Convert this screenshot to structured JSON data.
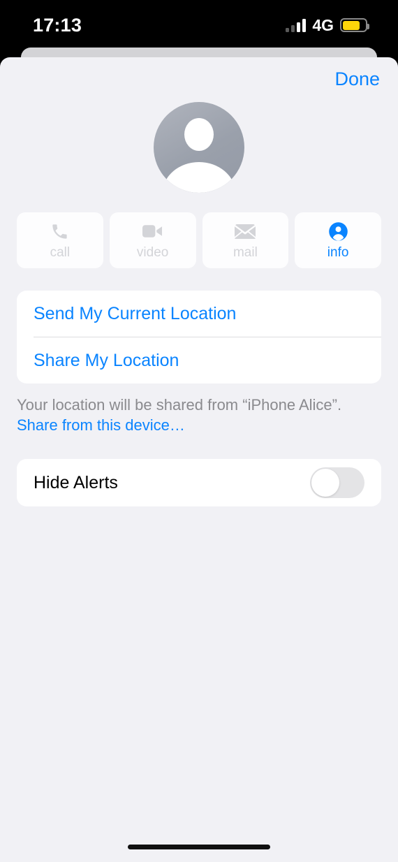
{
  "status_bar": {
    "time": "17:13",
    "network_label": "4G",
    "signal_icon": "signal-bars-icon",
    "signal_bars_active": 2,
    "signal_bars_total": 4,
    "battery_icon": "battery-icon",
    "battery_level_percent": 78,
    "battery_color": "#FFD60A"
  },
  "header": {
    "done_label": "Done"
  },
  "contact": {
    "avatar_icon": "default-person-avatar-icon"
  },
  "actions": [
    {
      "id": "call",
      "label": "call",
      "icon": "phone-icon",
      "enabled": false
    },
    {
      "id": "video",
      "label": "video",
      "icon": "video-camera-icon",
      "enabled": false
    },
    {
      "id": "mail",
      "label": "mail",
      "icon": "envelope-icon",
      "enabled": false
    },
    {
      "id": "info",
      "label": "info",
      "icon": "person-circle-icon",
      "enabled": true
    }
  ],
  "location_card": {
    "send_current_location_label": "Send My Current Location",
    "share_my_location_label": "Share My Location"
  },
  "footer": {
    "note": "Your location will be shared from “iPhone Alice”.",
    "link": "Share from this device…"
  },
  "alerts_card": {
    "hide_alerts_label": "Hide Alerts",
    "hide_alerts_on": false
  },
  "colors": {
    "accent_blue": "#0A84FF",
    "background": "#F1F1F5",
    "card": "#FFFFFF",
    "disabled_gray": "#D3D4D8",
    "note_gray": "#8A8A8E"
  },
  "system": {
    "home_indicator": "home-indicator"
  }
}
